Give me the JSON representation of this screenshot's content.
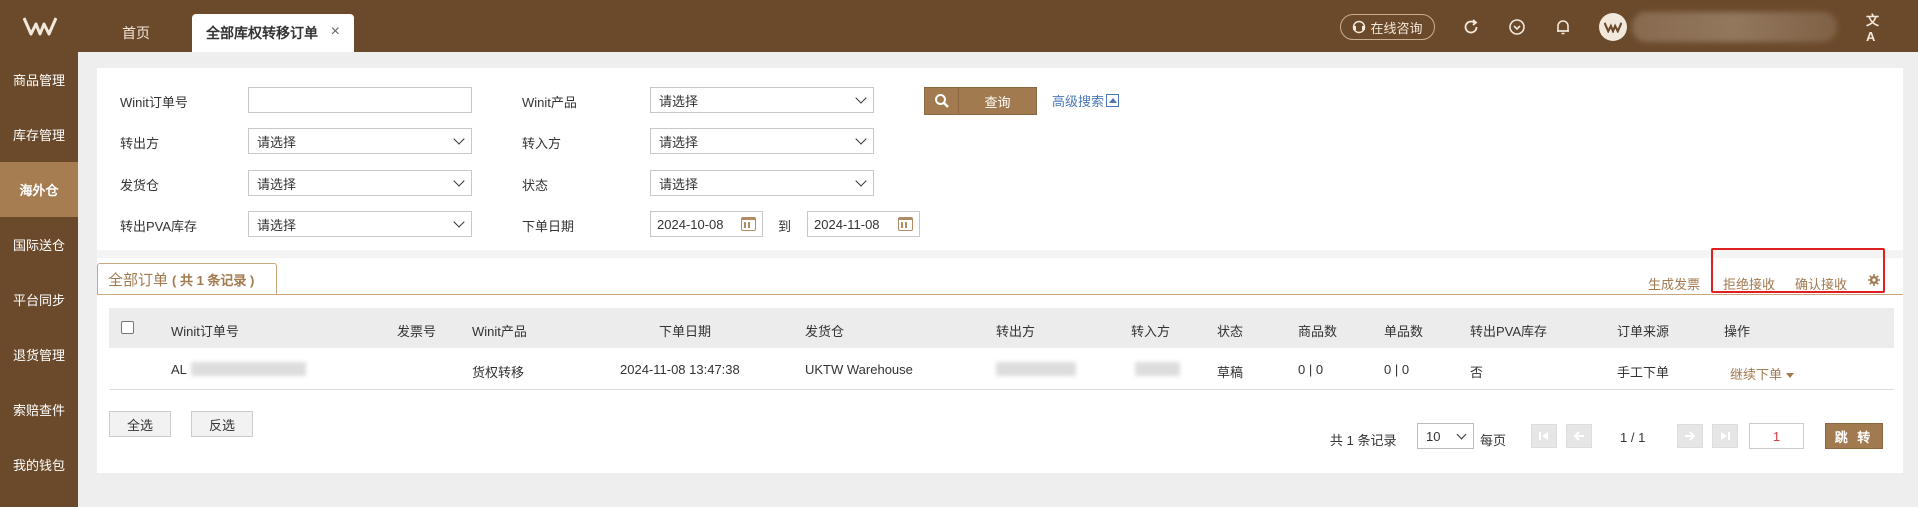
{
  "header": {
    "tabs": [
      {
        "label": "首页",
        "active": false
      },
      {
        "label": "全部库权转移订单",
        "active": true
      }
    ],
    "close_glyph": "×",
    "consult_label": "在线咨询",
    "icons": [
      "refresh-icon",
      "heart-circle-icon",
      "bell-icon",
      "translate-icon"
    ],
    "translate_glyph": "文A"
  },
  "sidebar": {
    "items": [
      {
        "label": "商品管理",
        "active": false
      },
      {
        "label": "库存管理",
        "active": false
      },
      {
        "label": "海外仓",
        "active": true
      },
      {
        "label": "国际送仓",
        "active": false
      },
      {
        "label": "平台同步",
        "active": false
      },
      {
        "label": "退货管理",
        "active": false
      },
      {
        "label": "索赔查件",
        "active": false
      },
      {
        "label": "我的钱包",
        "active": false
      }
    ]
  },
  "filters": {
    "order_no": {
      "label": "Winit订单号",
      "value": ""
    },
    "product": {
      "label": "Winit产品",
      "value": "请选择"
    },
    "from_party": {
      "label": "转出方",
      "value": "请选择"
    },
    "to_party": {
      "label": "转入方",
      "value": "请选择"
    },
    "warehouse": {
      "label": "发货仓",
      "value": "请选择"
    },
    "status": {
      "label": "状态",
      "value": "请选择"
    },
    "pva": {
      "label": "转出PVA库存",
      "value": "请选择"
    },
    "order_date": {
      "label": "下单日期",
      "start": "2024-10-08",
      "to": "到",
      "end": "2024-11-08"
    },
    "query_label": "查询",
    "advanced_label": "高级搜索"
  },
  "results": {
    "tab_title": "全部订单",
    "tab_count": "( 共 1 条记录 )",
    "actions": {
      "invoice": "生成发票",
      "reject": "拒绝接收",
      "accept": "确认接收"
    },
    "columns": [
      "Winit订单号",
      "发票号",
      "Winit产品",
      "下单日期",
      "发货仓",
      "转出方",
      "转入方",
      "状态",
      "商品数",
      "单品数",
      "转出PVA库存",
      "订单来源",
      "操作"
    ],
    "rows": [
      {
        "order_no": "AL",
        "invoice_no": "",
        "product": "货权转移",
        "date": "2024-11-08 13:47:38",
        "warehouse": "UKTW Warehouse",
        "from_party": "",
        "to_party": "",
        "status": "草稿",
        "item_count": "0 | 0",
        "unit_count": "0 | 0",
        "pva": "否",
        "source": "手工下单",
        "action": "继续下单"
      }
    ]
  },
  "footer": {
    "select_all": "全选",
    "invert": "反选",
    "total": "共 1 条记录",
    "page_size": "10",
    "per_page": "每页",
    "page_info": "1 / 1",
    "page_input": "1",
    "jump_label": "跳 转"
  },
  "colors": {
    "brand_dark": "#6b4a2b",
    "brand_accent": "#a27a4f",
    "highlight": "#e02020",
    "link": "#4a78b5"
  }
}
